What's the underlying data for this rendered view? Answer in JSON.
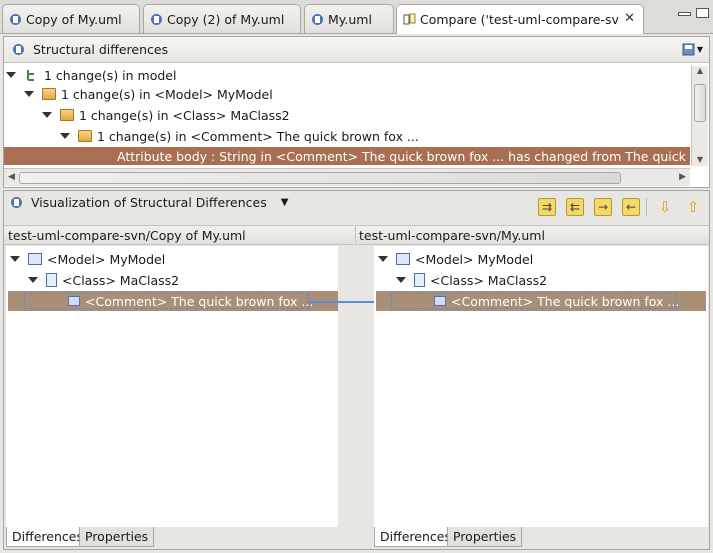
{
  "tabs": [
    {
      "label": "Copy of My.uml"
    },
    {
      "label": "Copy (2) of My.uml"
    },
    {
      "label": "My.uml"
    },
    {
      "label": "Compare ('test-uml-compare-sv"
    }
  ],
  "structural": {
    "title": "Structural differences",
    "tree": [
      {
        "label": "1 change(s) in model"
      },
      {
        "label": "1 change(s) in <Model> MyModel"
      },
      {
        "label": "1 change(s) in <Class> MaClass2"
      },
      {
        "label": "1 change(s) in <Comment> The quick brown fox ..."
      },
      {
        "label": "Attribute body : String in <Comment> The quick brown fox ... has changed from The quick br"
      }
    ]
  },
  "visualization": {
    "title": "Visualization of Structural Differences"
  },
  "left_pane": {
    "path": "test-uml-compare-svn/Copy of My.uml",
    "tree": [
      {
        "label": "<Model> MyModel"
      },
      {
        "label": "<Class> MaClass2"
      },
      {
        "label": "<Comment> The quick brown fox ..."
      }
    ],
    "tabs": [
      "Differences",
      "Properties"
    ]
  },
  "right_pane": {
    "path": "test-uml-compare-svn/My.uml",
    "tree": [
      {
        "label": "<Model> MyModel"
      },
      {
        "label": "<Class> MaClass2"
      },
      {
        "label": "<Comment> The quick brown fox ..."
      }
    ],
    "tabs": [
      "Differences",
      "Properties"
    ]
  },
  "colors": {
    "highlight": "#a86f52",
    "selection": "#aa8f76"
  }
}
